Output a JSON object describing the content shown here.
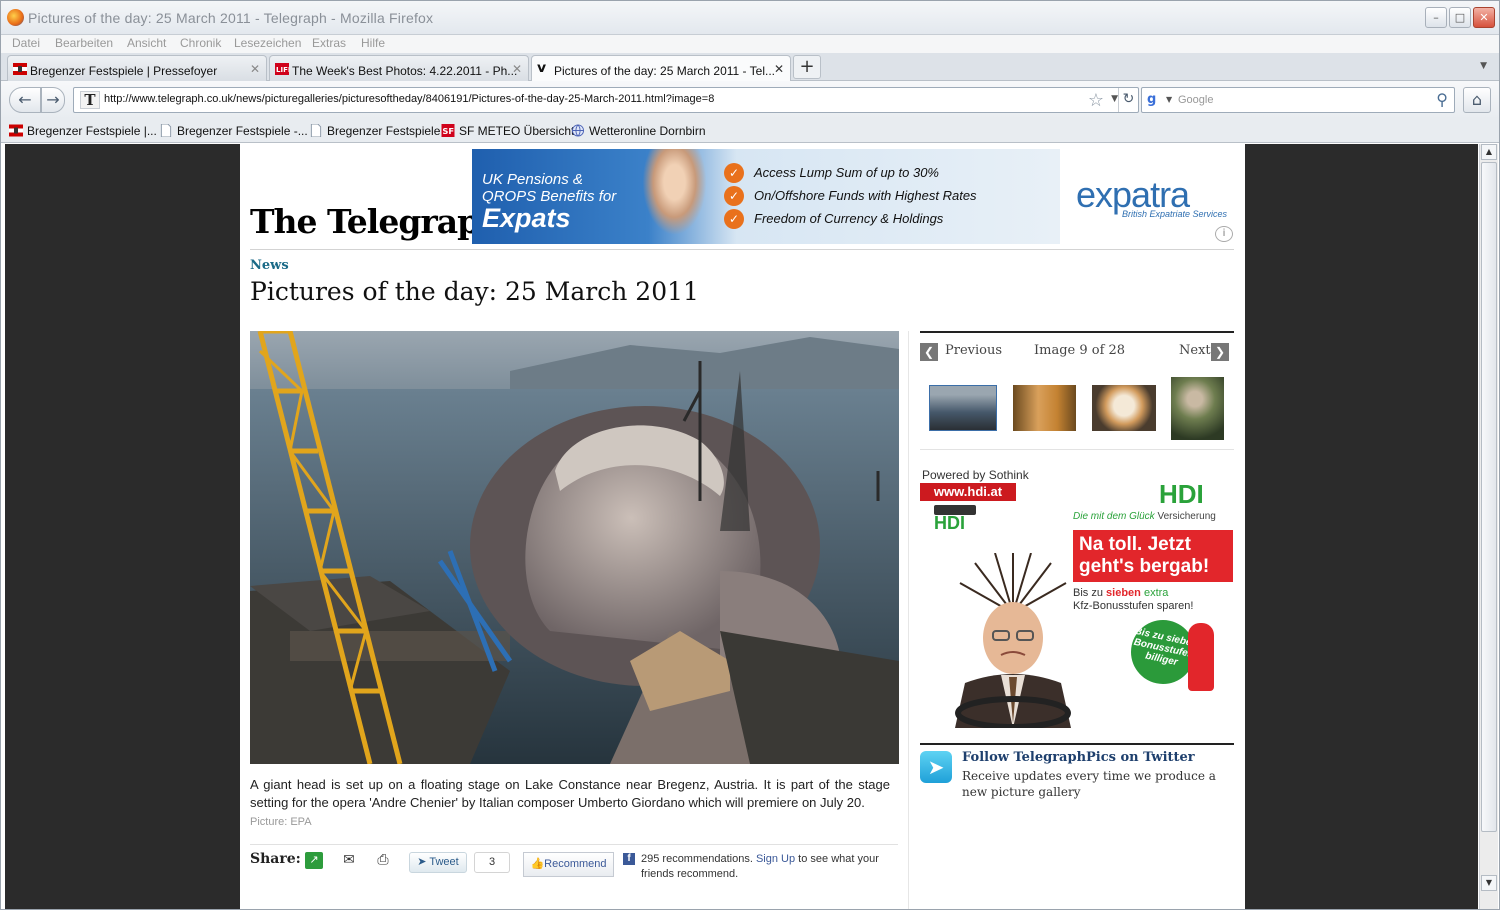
{
  "window": {
    "title": "Pictures of the day: 25 March 2011 - Telegraph - Mozilla Firefox"
  },
  "menu": [
    "Datei",
    "Bearbeiten",
    "Ansicht",
    "Chronik",
    "Lesezeichen",
    "Extras",
    "Hilfe"
  ],
  "tabs": [
    {
      "label": "Bregenzer Festspiele | Pressefoyer",
      "active": false
    },
    {
      "label": "The Week's Best Photos: 4.22.2011 - Ph...",
      "active": false
    },
    {
      "label": "Pictures of the day: 25 March 2011 - Tel...",
      "active": true
    }
  ],
  "toolbar": {
    "url": "http://www.telegraph.co.uk/news/picturegalleries/picturesoftheday/8406191/Pictures-of-the-day-25-March-2011.html?image=8",
    "search_placeholder": "Google"
  },
  "bookmarks": [
    "Bregenzer Festspiele |...",
    "Bregenzer Festspiele -...",
    "Bregenzer Festspiele",
    "SF METEO Übersicht",
    "Wetteronline Dornbirn"
  ],
  "page": {
    "logo": "The Telegraph",
    "section": "News",
    "title": "Pictures of the day: 25 March 2011",
    "caption": "A giant head is set up on a floating stage on Lake Constance near Bregenz, Austria. It is part of the stage setting for the opera 'Andre Chenier' by Italian composer Umberto Giordano which will premiere on July 20.",
    "credit": "Picture: EPA",
    "share_label": "Share:",
    "tweet_label": "Tweet",
    "tweet_count": "3",
    "recommend_label": "Recommend",
    "fb_text_before": "295 recommendations.",
    "fb_signup": "Sign Up",
    "fb_text_after": "to see what your friends recommend."
  },
  "banner_ad": {
    "line1": "UK Pensions &",
    "line2": "QROPS Benefits for",
    "line3": "Expats",
    "bullets": [
      "Access Lump Sum of up to 30%",
      "On/Offshore Funds with Highest Rates",
      "Freedom of Currency & Holdings"
    ],
    "brand": "expatra",
    "brand_sub": "British Expatriate Services"
  },
  "gallery": {
    "previous": "Previous",
    "next": "Next",
    "counter": "Image 9 of 28"
  },
  "side_ad": {
    "powered": "Powered by Sothink",
    "url": "www.hdi.at",
    "logo": "HDI",
    "tagline_script": "Die mit dem Glück",
    "tagline": "Versicherung",
    "headline_1": "Na toll. Jetzt",
    "headline_2": "geht's bergab!",
    "sub_1": "Bis zu",
    "sub_red": "sieben",
    "sub_green": "extra",
    "sub_2": "Kfz-Bonusstufen sparen!",
    "badge": "Bis zu sieben Bonusstufen billiger"
  },
  "twitter": {
    "title": "Follow TelegraphPics on Twitter",
    "text": "Receive updates every time we produce a new picture gallery"
  }
}
